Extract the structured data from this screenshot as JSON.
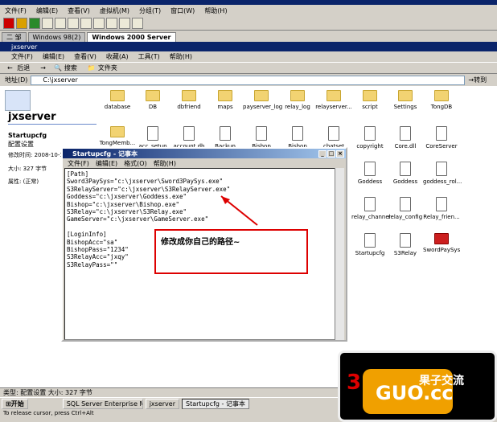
{
  "vm": {
    "menu": [
      "文件(F)",
      "编辑(E)",
      "查看(V)",
      "虚拟机(M)",
      "分组(T)",
      "窗口(W)",
      "帮助(H)"
    ],
    "tabs": [
      "二 邹",
      "Windows 98(2)",
      "Windows 2000 Server"
    ]
  },
  "explorer": {
    "title": "jxserver",
    "menu": [
      "文件(F)",
      "编辑(E)",
      "查看(V)",
      "收藏(A)",
      "工具(T)",
      "帮助(H)"
    ],
    "toolbar": [
      "后退",
      "搜索",
      "文件夹"
    ],
    "address_label": "地址(D)",
    "address": "C:\\jxserver",
    "go": "转到",
    "left_title": "jxserver",
    "selected_name": "Startupcfg",
    "selected_type": "配置设置",
    "modified": "修改时间: 2008-10-1",
    "size": "大小: 327 字节",
    "attrs": "属性: (正常)",
    "items_row1": [
      "database",
      "DB",
      "dbfriend",
      "maps",
      "payserver_log",
      "relay_log",
      "relayserver...",
      "script",
      "Settings",
      "TongDB"
    ],
    "items_row2": [
      "TongMemb...",
      "acc_setup",
      "account.db",
      "Backup",
      "Bishop",
      "Bishop",
      "chatset",
      "copyright",
      "Core.dll",
      "CoreServer"
    ],
    "items_row3": [
      "Goddess",
      "Goddess",
      "goddess_rol..."
    ],
    "items_row4": [
      "relay_channel",
      "relay_config",
      "Relay_frien..."
    ],
    "items_row5": [
      "Startupcfg",
      "S3Relay",
      "SwordPaySys"
    ],
    "status": "类型: 配置设置 大小: 327 字节"
  },
  "notepad": {
    "title": "Startupcfg - 记事本",
    "menu": [
      "文件(F)",
      "编辑(E)",
      "格式(O)",
      "帮助(H)"
    ],
    "lines": [
      "[Path]",
      "Sword3PaySys=\"c:\\jxserver\\Sword3PaySys.exe\"",
      "S3RelayServer=\"c:\\jxserver\\S3RelayServer.exe\"",
      "Goddess=\"c:\\jxserver\\Goddess.exe\"",
      "Bishop=\"c:\\jxserver\\Bishop.exe\"",
      "S3Relay=\"c:\\jxserver\\S3Relay.exe\"",
      "GameServer=\"c:\\jxserver\\GameServer.exe\"",
      "",
      "[LoginInfo]",
      "BishopAcc=\"sa\"",
      "BishopPass=\"1234\"",
      "S3RelayAcc=\"jxqy\"",
      "S3RelayPass=\"\""
    ]
  },
  "annotation": "修改成你自己的路径~",
  "taskbar": {
    "start": "开始",
    "tasks": [
      "SQL Server Enterprise Ma...",
      "jxserver",
      "Startupcfg - 记事本"
    ]
  },
  "hint": "To release cursor, press Ctrl+Alt",
  "watermark": {
    "brand": "GUO.cc",
    "cn": "果子交流",
    "digit": "3"
  }
}
